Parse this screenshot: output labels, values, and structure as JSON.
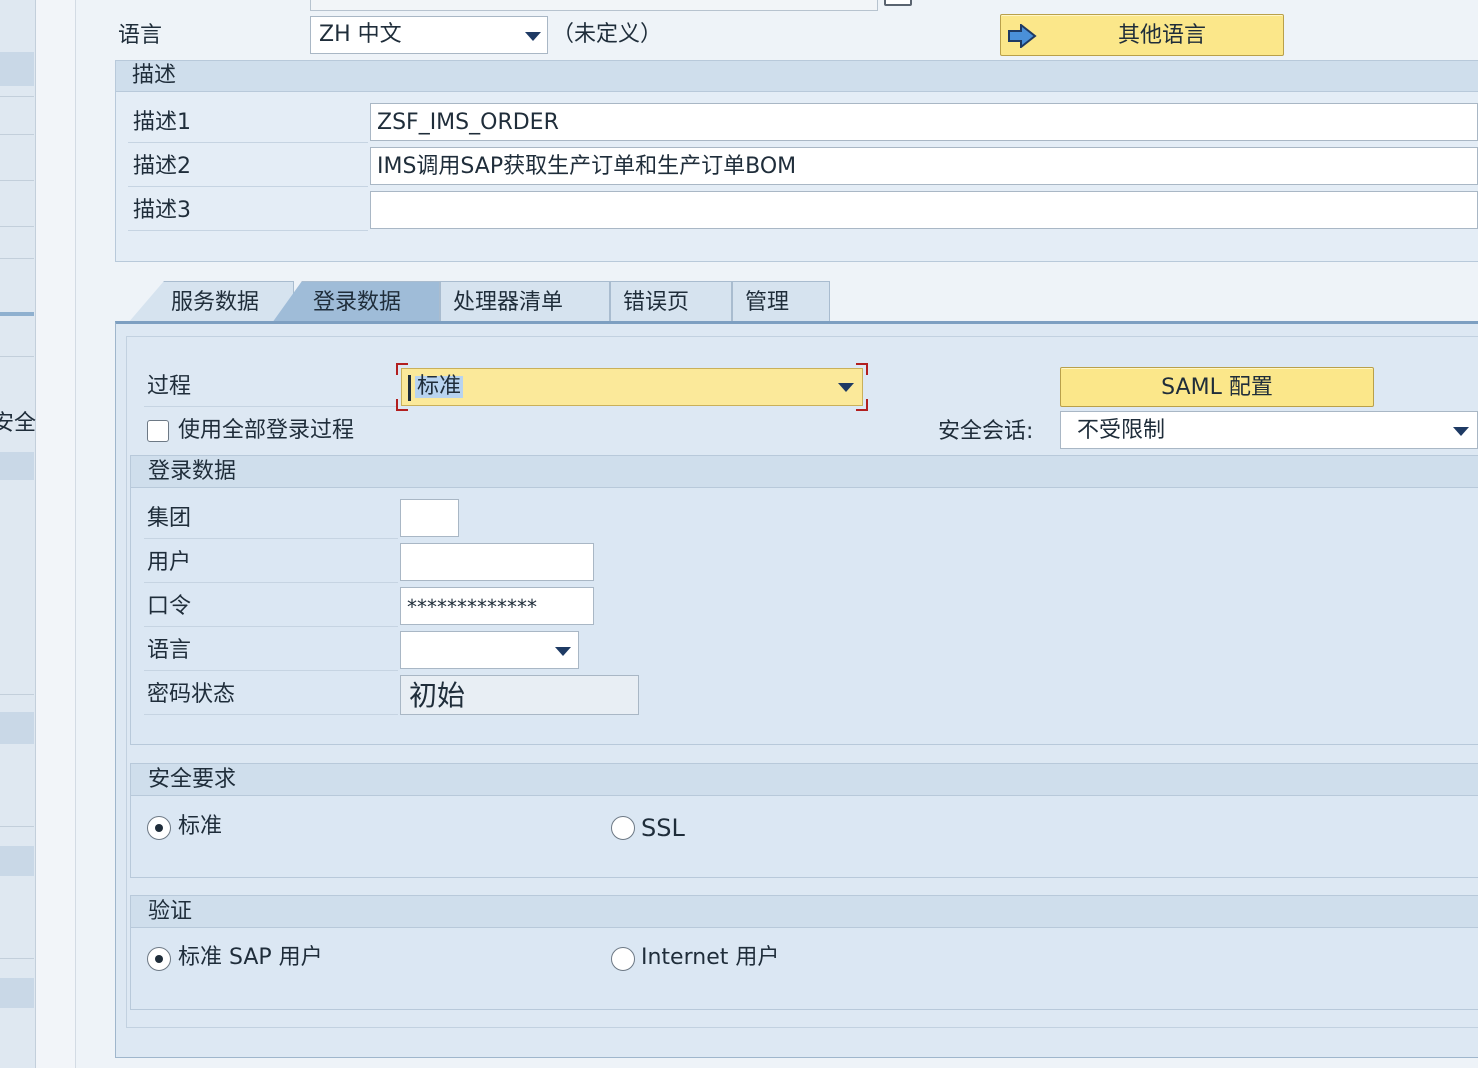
{
  "header": {
    "language_label": "语言",
    "language_value": "ZH 中文",
    "language_note": "（未定义）",
    "other_language_button": "其他语言"
  },
  "description": {
    "title": "描述",
    "rows": [
      {
        "label": "描述1",
        "value": "ZSF_IMS_ORDER"
      },
      {
        "label": "描述2",
        "value": "IMS调用SAP获取生产订单和生产订单BOM"
      },
      {
        "label": "描述3",
        "value": ""
      }
    ]
  },
  "tabs": [
    {
      "label": "服务数据"
    },
    {
      "label": "登录数据",
      "active": true
    },
    {
      "label": "处理器清单"
    },
    {
      "label": "错误页"
    },
    {
      "label": "管理"
    }
  ],
  "logon": {
    "procedure_label": "过程",
    "procedure_value": "标准",
    "saml_button": "SAML 配置",
    "use_all_label": "使用全部登录过程",
    "use_all_checked": false,
    "secure_session_label": "安全会话:",
    "secure_session_value": "不受限制",
    "sidebar_fragment": "安全"
  },
  "logon_data": {
    "title": "登录数据",
    "client_label": "集团",
    "client_value": "",
    "user_label": "用户",
    "user_value": "",
    "password_label": "口令",
    "password_value": "*************",
    "language_label": "语言",
    "language_value": "",
    "pw_status_label": "密码状态",
    "pw_status_value": "初始"
  },
  "security": {
    "title": "安全要求",
    "options": [
      {
        "label": "标准",
        "selected": true
      },
      {
        "label": "SSL",
        "selected": false
      }
    ]
  },
  "authentication": {
    "title": "验证",
    "options": [
      {
        "label": "标准 SAP 用户",
        "selected": true
      },
      {
        "label": "Internet 用户",
        "selected": false
      }
    ]
  },
  "colors": {
    "button_yellow": "#fbe78a",
    "focus_yellow": "#fbe99a",
    "focus_border": "#b21f1f",
    "tab_active": "#9fbcd8"
  }
}
